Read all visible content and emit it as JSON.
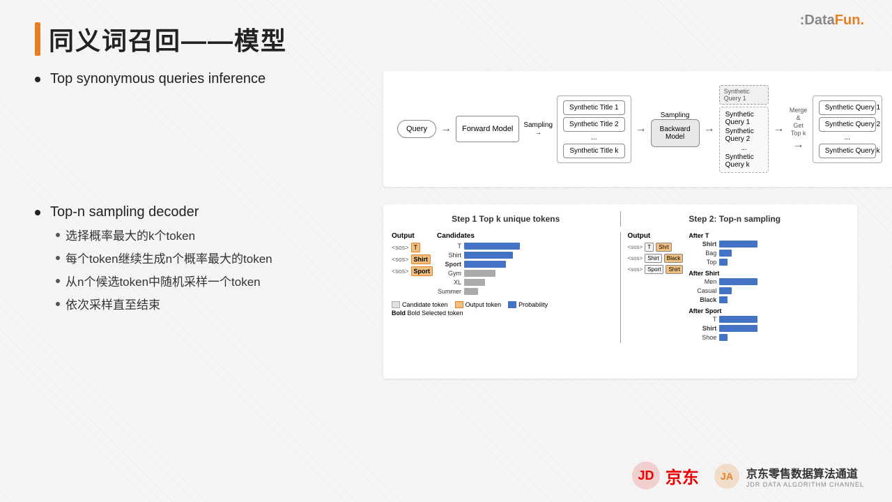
{
  "header": {
    "title": "同义词召回——模型",
    "logo": "DataFun."
  },
  "section1": {
    "label": "Top synonymous queries inference"
  },
  "section2": {
    "label": "Top-n sampling decoder",
    "sub_bullets": [
      "选择概率最大的k个token",
      "每个token继续生成n个概率最大的token",
      "从n个候选token中随机采样一个token",
      "依次采样直至结束"
    ]
  },
  "diagram": {
    "query_label": "Query",
    "forward_model": "Forward Model",
    "sampling1": "Sampling",
    "sampling2": "Sampling",
    "backward_model": "Backward Model",
    "synthetic_titles": [
      "Synthetic Title 1",
      "Synthetic Title 2",
      "...",
      "Synthetic Title k"
    ],
    "merge_label": "Merge &\nGet Top k",
    "synthetic_queries_mid": [
      "Synthetic Query 1",
      "Synthetic Query 2",
      "...",
      "Synthetic Query k"
    ],
    "synthetic_queries_out": [
      "Synthetic Query 1",
      "Synthetic Query 2",
      "...",
      "Synthetic Query k"
    ],
    "query1_label": "Synthetic Query 1",
    "query2_label": "Synthetic Query 2",
    "queryk_label": "Synthetic Query k",
    "query1_top": "Query !",
    "query2_top": "Synthetic Query 2"
  },
  "sampling_diagram": {
    "step1_title": "Step 1 Top k unique tokens",
    "step2_title": "Step 2: Top-n sampling",
    "output_label": "Output",
    "candidates_label": "Candidates",
    "tokens": [
      "T",
      "Shirt",
      "Sport"
    ],
    "candidates": [
      "T",
      "Shirt",
      "Sport",
      "Gym",
      "XL",
      "Summer"
    ],
    "candidate_bars": [
      80,
      70,
      60,
      45,
      30,
      20
    ],
    "after_t_title": "After T",
    "after_shirt_title": "After Shirt",
    "after_sport_title": "After Sport",
    "after_t_items": [
      "Shirt",
      "Bag",
      "Top"
    ],
    "after_shirt_items": [
      "Men",
      "Casual",
      "Black"
    ],
    "after_sport_items": [
      "T",
      "Shirt",
      "Shoe"
    ],
    "legend": {
      "candidate": "Candidate token",
      "output": "Output token",
      "probability": "Probability",
      "bold_note": "Bold Selected token"
    }
  },
  "footer": {
    "jd_text": "京东",
    "channel_text": "京东零售数据算法通道",
    "sub_text": "JDR DATA ALGORITHM CHANNEL"
  }
}
